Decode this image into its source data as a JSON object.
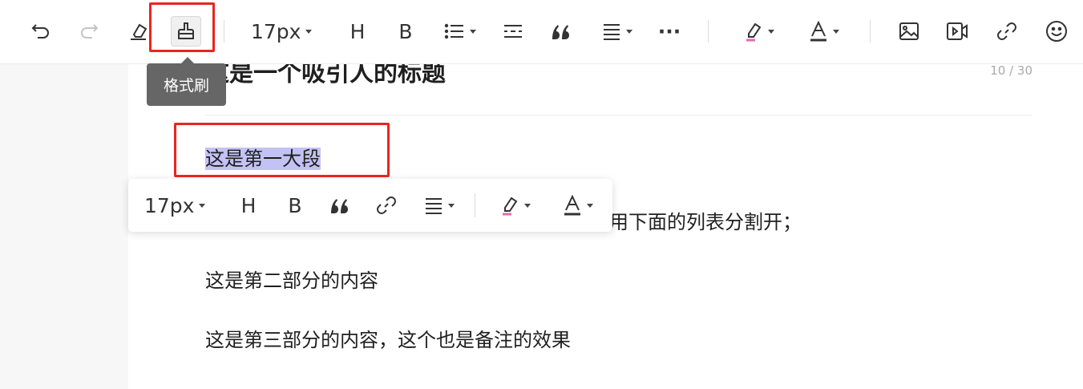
{
  "toolbar": {
    "font_size": "17px",
    "heading_label": "H",
    "bold_label": "B",
    "more_label": "···",
    "format_painter_tooltip": "格式刷"
  },
  "document": {
    "title": "这是一个吸引人的标题",
    "title_count": "10 / 30",
    "paragraphs": [
      "这是第一大段",
      "用下面的列表分割开；",
      "这是第二部分的内容",
      "这是第三部分的内容，这个也是备注的效果"
    ]
  },
  "floating_toolbar": {
    "font_size": "17px",
    "heading_label": "H",
    "bold_label": "B"
  },
  "colors": {
    "highlight": "#c3c2f5",
    "annotation_red": "#e8261f",
    "tooltip_bg": "#666666",
    "highlight_underline": "#e86aa8"
  }
}
